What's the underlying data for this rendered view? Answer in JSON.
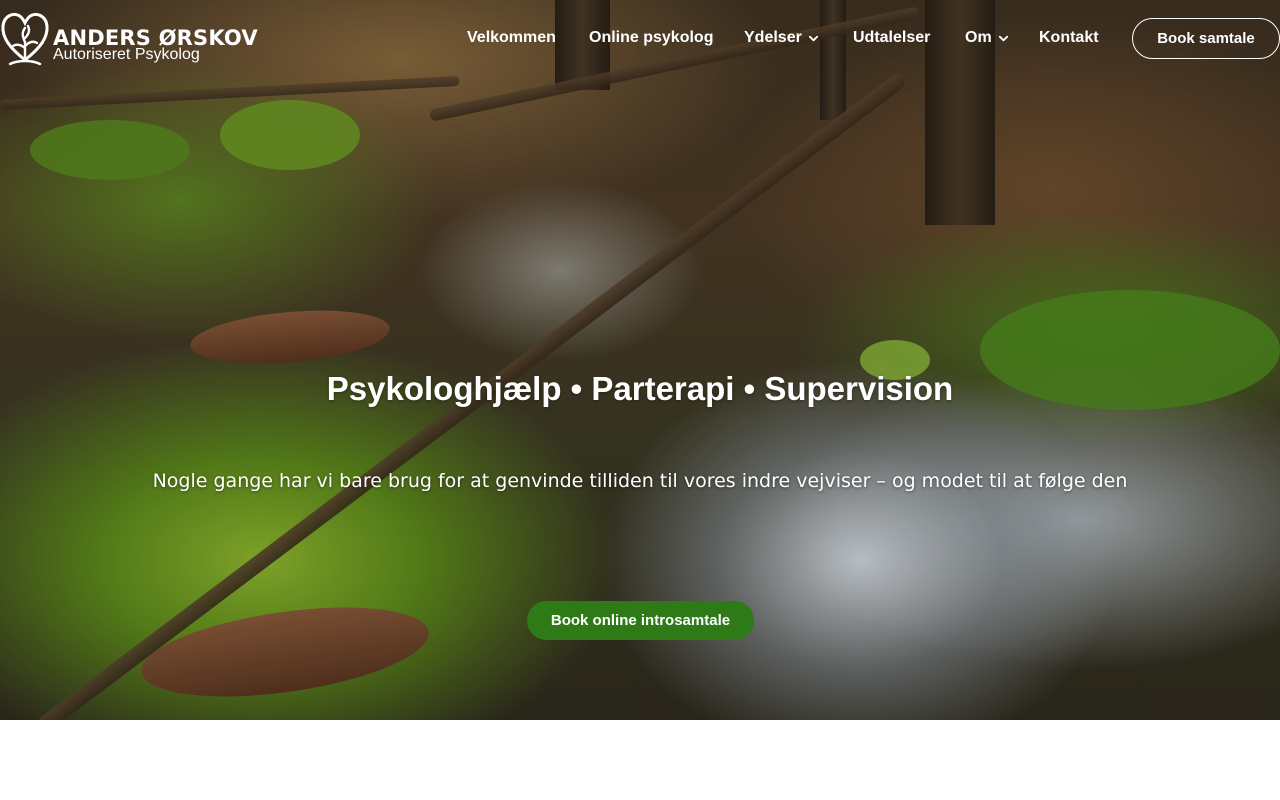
{
  "brand": {
    "name": "ANDERS ØRSKOV",
    "subtitle": "Autoriseret Psykolog",
    "logo_icon": "heart-tree-logo-icon"
  },
  "nav": {
    "items": [
      {
        "label": "Velkommen",
        "has_dropdown": false
      },
      {
        "label": "Online psykolog",
        "has_dropdown": false
      },
      {
        "label": "Ydelser",
        "has_dropdown": true
      },
      {
        "label": "Udtalelser",
        "has_dropdown": false
      },
      {
        "label": "Om",
        "has_dropdown": true
      },
      {
        "label": "Kontakt",
        "has_dropdown": false
      }
    ],
    "book_button": "Book samtale",
    "dropdown_icon": "chevron-down-icon"
  },
  "hero": {
    "headline": "Psykologhjælp • Parterapi • Supervision",
    "tagline": "Nogle gange har vi bare brug for at genvinde tilliden til vores indre vejviser – og modet til at følge den",
    "cta_label": "Book online introsamtale",
    "background": "forest-stream-photo"
  },
  "colors": {
    "cta_green": "#2e7a17",
    "text": "#ffffff",
    "page_background": "#ffffff"
  }
}
